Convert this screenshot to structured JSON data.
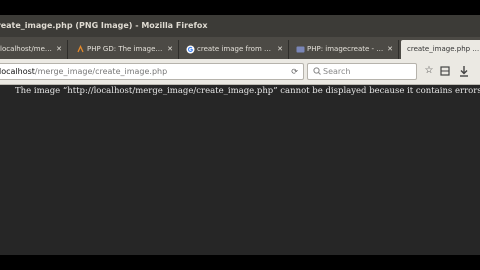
{
  "window": {
    "title": "create_image.php (PNG Image) - Mozilla Firefox"
  },
  "tabs": [
    {
      "label": "localhost/merge_image/",
      "favicon": "page-icon"
    },
    {
      "label": "PHP GD: The image cannot be displayed",
      "favicon": "stackoverflow-icon"
    },
    {
      "label": "create image from php - Google Search",
      "favicon": "google-icon"
    },
    {
      "label": "PHP: imagecreate - Manual",
      "favicon": "php-icon"
    },
    {
      "label": "create_image.php (PNG Image)",
      "favicon": "none",
      "active": true
    }
  ],
  "navbar": {
    "url_host": "localhost",
    "url_path": "/merge_image/create_image.php",
    "search_placeholder": "Search"
  },
  "content": {
    "error_message": "The image “http://localhost/merge_image/create_image.php” cannot be displayed because it contains errors."
  },
  "colors": {
    "content_bg": "#262626",
    "chrome_bg": "#3c3b37",
    "navbar_bg": "#ebe9e3"
  }
}
